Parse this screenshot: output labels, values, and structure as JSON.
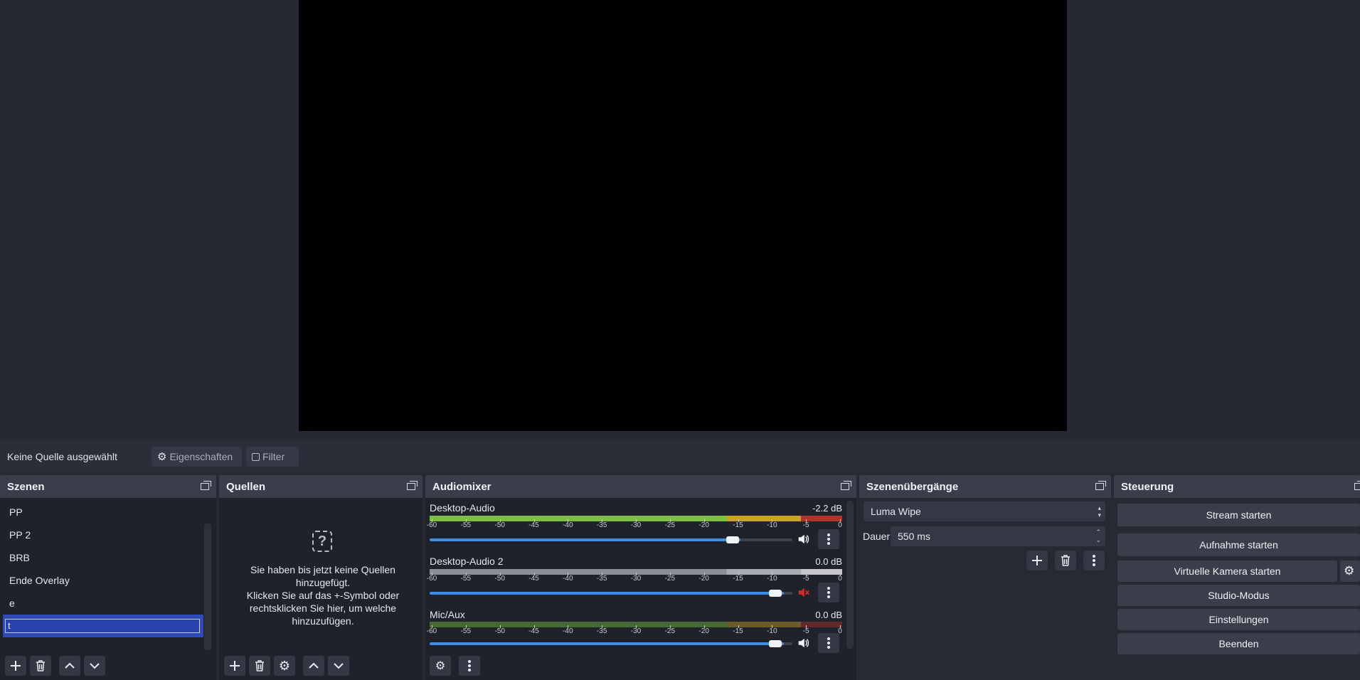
{
  "preview": {},
  "source_toolbar": {
    "no_source_label": "Keine Quelle ausgewählt",
    "properties_label": "Eigenschaften",
    "filter_label": "Filter"
  },
  "scenes": {
    "title": "Szenen",
    "items": [
      {
        "label": "PP"
      },
      {
        "label": "PP 2"
      },
      {
        "label": "BRB"
      },
      {
        "label": "Ende Overlay"
      },
      {
        "label": "e"
      },
      {
        "label": "t",
        "selected": true
      }
    ]
  },
  "sources": {
    "title": "Quellen",
    "empty_line1": "Sie haben bis jetzt keine Quellen hinzugefügt.",
    "empty_line2": "Klicken Sie auf das +-Symbol oder rechtsklicken Sie hier, um welche hinzuzufügen.",
    "empty_icon": "?"
  },
  "mixer": {
    "title": "Audiomixer",
    "ticks": [
      "-60",
      "-55",
      "-50",
      "-45",
      "-40",
      "-35",
      "-30",
      "-25",
      "-20",
      "-15",
      "-10",
      "-5",
      "0"
    ],
    "channels": [
      {
        "name": "Desktop-Audio",
        "db": "-2.2 dB",
        "volume": 0.88,
        "muted": false,
        "active": true
      },
      {
        "name": "Desktop-Audio 2",
        "db": "0.0 dB",
        "volume": 1.0,
        "muted": true,
        "active": false
      },
      {
        "name": "Mic/Aux",
        "db": "0.0 dB",
        "volume": 1.0,
        "muted": false,
        "active": true
      }
    ]
  },
  "transitions": {
    "title": "Szenenübergänge",
    "selected": "Luma Wipe",
    "duration_label": "Dauer",
    "duration_value": "550 ms"
  },
  "controls": {
    "title": "Steuerung",
    "stream": "Stream starten",
    "record": "Aufnahme starten",
    "virtual_cam": "Virtuelle Kamera starten",
    "studio": "Studio-Modus",
    "settings": "Einstellungen",
    "exit": "Beenden"
  },
  "colors": {
    "meter_green": "#7bc043",
    "meter_yellow": "#c9a227",
    "meter_red": "#b0342a",
    "accent_blue": "#3b8fe6",
    "selection": "#2e4ab9",
    "muted_red": "#d02a2a"
  }
}
